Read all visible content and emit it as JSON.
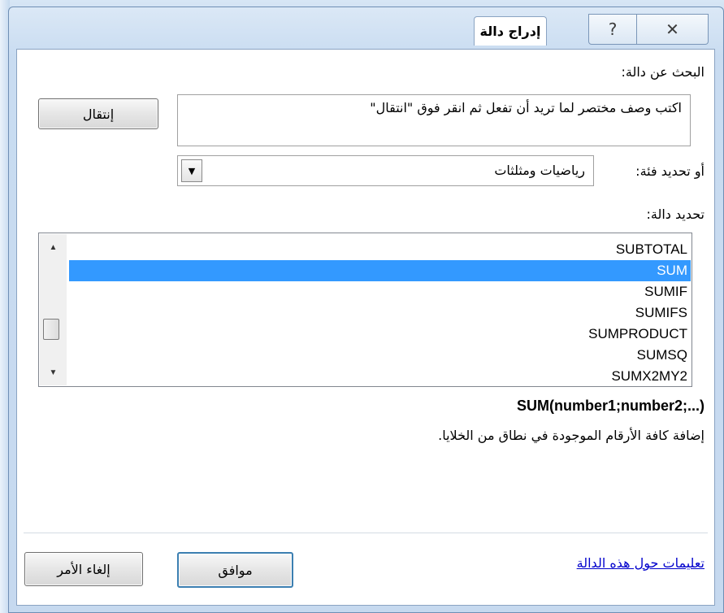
{
  "window": {
    "title": "إدراج دالة",
    "help_glyph": "?",
    "close_glyph": "✕"
  },
  "search": {
    "label": "البحث عن دالة:",
    "value": "اكتب وصف مختصر لما تريد أن تفعل ثم انقر فوق \"انتقال\"",
    "go_button": "إنتقال"
  },
  "category": {
    "label": "أو تحديد فئة:",
    "selected": "رياضيات ومثلثات"
  },
  "function_list": {
    "label": "تحديد دالة:",
    "items": [
      "SUBTOTAL",
      "SUM",
      "SUMIF",
      "SUMIFS",
      "SUMPRODUCT",
      "SUMSQ",
      "SUMX2MY2"
    ],
    "selected_index": 1
  },
  "details": {
    "signature": "SUM(number1;number2;...)",
    "description": "إضافة كافة الأرقام الموجودة في نطاق من الخلايا."
  },
  "footer": {
    "help_link": "تعليمات حول هذه الدالة",
    "ok_button": "موافق",
    "cancel_button": "إلغاء الأمر"
  },
  "colors": {
    "selection": "#3399ff",
    "link": "#0000cc",
    "default_button_border": "#3c7fb1"
  },
  "icons": {
    "scroll_up": "▲",
    "scroll_down": "▼",
    "dropdown": "▼"
  }
}
